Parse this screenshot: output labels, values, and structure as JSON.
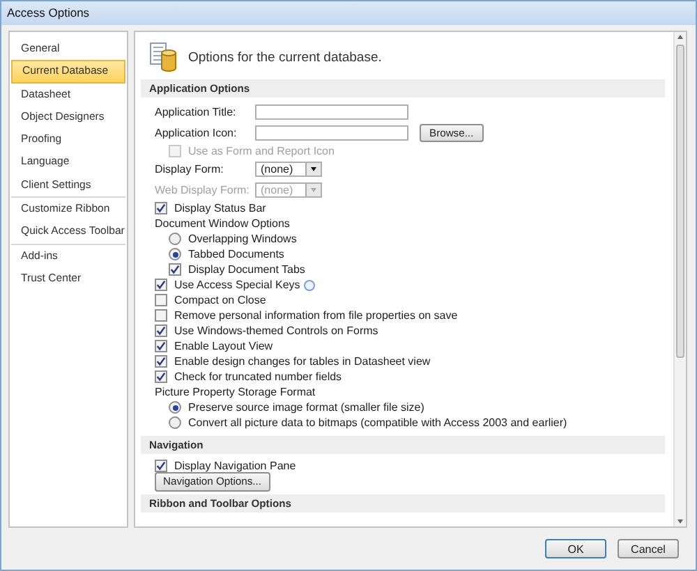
{
  "window": {
    "title": "Access Options"
  },
  "sidebar": {
    "groups": [
      [
        {
          "label": "General",
          "selected": false
        },
        {
          "label": "Current Database",
          "selected": true
        },
        {
          "label": "Datasheet",
          "selected": false
        },
        {
          "label": "Object Designers",
          "selected": false
        },
        {
          "label": "Proofing",
          "selected": false
        },
        {
          "label": "Language",
          "selected": false
        },
        {
          "label": "Client Settings",
          "selected": false
        }
      ],
      [
        {
          "label": "Customize Ribbon",
          "selected": false
        },
        {
          "label": "Quick Access Toolbar",
          "selected": false
        }
      ],
      [
        {
          "label": "Add-ins",
          "selected": false
        },
        {
          "label": "Trust Center",
          "selected": false
        }
      ]
    ]
  },
  "header": {
    "text": "Options for the current database."
  },
  "sections": [
    {
      "title": "Application Options",
      "items": [
        {
          "kind": "text",
          "label": "Application Title:",
          "disabled": false
        },
        {
          "kind": "text",
          "label": "Application Icon:",
          "disabled": false,
          "button": "Browse...",
          "children": [
            {
              "kind": "checkbox",
              "label": "Use as Form and Report Icon",
              "checked": false,
              "disabled": true
            }
          ]
        },
        {
          "kind": "dropdown",
          "label": "Display Form:",
          "value": "(none)",
          "disabled": false
        },
        {
          "kind": "dropdown",
          "label": "Web Display Form:",
          "value": "(none)",
          "disabled": true
        },
        {
          "kind": "checkbox",
          "label": "Display Status Bar",
          "checked": true,
          "disabled": false
        },
        {
          "kind": "group",
          "label": "Document Window Options",
          "children": [
            {
              "kind": "radio",
              "label": "Overlapping Windows",
              "selected": false
            },
            {
              "kind": "radio",
              "label": "Tabbed Documents",
              "selected": true
            },
            {
              "kind": "checkbox",
              "label": "Display Document Tabs",
              "checked": true,
              "disabled": false
            }
          ]
        },
        {
          "kind": "checkbox",
          "label": "Use Access Special Keys",
          "checked": true,
          "disabled": false,
          "info": true
        },
        {
          "kind": "checkbox",
          "label": "Compact on Close",
          "checked": false,
          "disabled": false
        },
        {
          "kind": "checkbox",
          "label": "Remove personal information from file properties on save",
          "checked": false,
          "disabled": false
        },
        {
          "kind": "checkbox",
          "label": "Use Windows-themed Controls on Forms",
          "checked": true,
          "disabled": false
        },
        {
          "kind": "checkbox",
          "label": "Enable Layout View",
          "checked": true,
          "disabled": false
        },
        {
          "kind": "checkbox",
          "label": "Enable design changes for tables in Datasheet view",
          "checked": true,
          "disabled": false
        },
        {
          "kind": "checkbox",
          "label": "Check for truncated number fields",
          "checked": true,
          "disabled": false
        },
        {
          "kind": "group",
          "label": "Picture Property Storage Format",
          "children": [
            {
              "kind": "radio",
              "label": "Preserve source image format (smaller file size)",
              "selected": true
            },
            {
              "kind": "radio",
              "label": "Convert all picture data to bitmaps (compatible with Access 2003 and earlier)",
              "selected": false
            }
          ]
        }
      ]
    },
    {
      "title": "Navigation",
      "items": [
        {
          "kind": "checkbox",
          "label": "Display Navigation Pane",
          "checked": true,
          "disabled": false
        },
        {
          "kind": "button",
          "label": "Navigation Options..."
        }
      ]
    },
    {
      "title": "Ribbon and Toolbar Options"
    }
  ],
  "buttons": [
    "OK",
    "Cancel"
  ]
}
